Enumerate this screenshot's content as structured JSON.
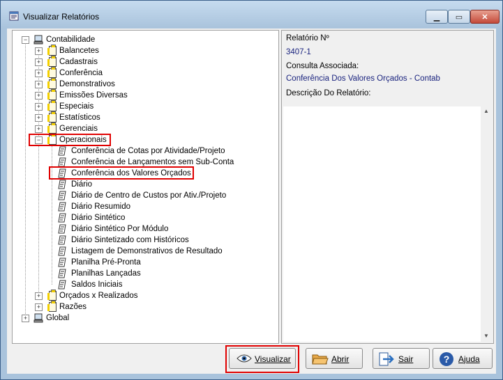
{
  "window": {
    "title": "Visualizar Relatórios"
  },
  "tree": {
    "root_contabilidade": "Contabilidade",
    "groups": [
      "Balancetes",
      "Cadastrais",
      "Conferência",
      "Demonstrativos",
      "Emissões Diversas",
      "Especiais",
      "Estatísticos",
      "Gerenciais",
      "Operacionais"
    ],
    "reports": [
      "Conferência de Cotas por Atividade/Projeto",
      "Conferência de Lançamentos sem Sub-Conta",
      "Conferência dos Valores Orçados",
      "Diário",
      "Diário de Centro de Custos por Ativ./Projeto",
      "Diário Resumido",
      "Diário Sintético",
      "Diário Sintético Por Módulo",
      "Diário Sintetizado com Históricos",
      "Listagem de Demonstrativos de Resultado",
      "Planilha Pré-Pronta",
      "Planilhas Lançadas",
      "Saldos Iniciais"
    ],
    "after_groups": [
      "Orçados x Realizados",
      "Razões"
    ],
    "root_global": "Global"
  },
  "info": {
    "report_no_label": "Relatório Nº",
    "report_no_value": "3407-1",
    "query_label": "Consulta Associada:",
    "query_value": "Conferência Dos Valores Orçados - Contab",
    "desc_label": "Descrição Do Relatório:"
  },
  "buttons": {
    "visualizar": "Visualizar",
    "abrir": "Abrir",
    "sair": "Sair",
    "ajuda": "Ajuda"
  },
  "highlight_color": "#e00000"
}
